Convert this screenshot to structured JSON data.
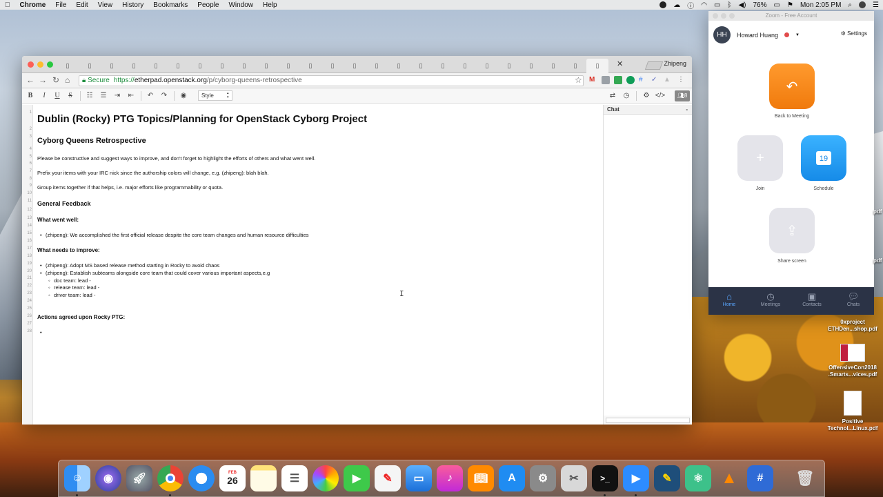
{
  "menubar": {
    "apple": "",
    "app": "Chrome",
    "items": [
      "File",
      "Edit",
      "View",
      "History",
      "Bookmarks",
      "People",
      "Window",
      "Help"
    ],
    "battery": "76%",
    "clock": "Mon 2:05 PM"
  },
  "browser": {
    "profile": "Zhipeng",
    "tab_icon": "etherpad-favicon",
    "url": {
      "secure_label": "Secure",
      "scheme": "https://",
      "host": "etherpad.openstack.org",
      "path": "/p/cyborg-queens-retrospective"
    }
  },
  "toolbar": {
    "bold": "B",
    "italic": "I",
    "underline": "U",
    "strike": "S",
    "style_select": "Style",
    "users_count": "8"
  },
  "document": {
    "line_numbers": [
      "1",
      "2",
      "3",
      "4",
      "5",
      "6",
      "7",
      "8",
      "9",
      "10",
      "11",
      "12",
      "13",
      "14",
      "15",
      "16",
      "17",
      "18",
      "19",
      "20",
      "21",
      "22",
      "23",
      "24",
      "25",
      "26",
      "27",
      "28"
    ],
    "title": "Dublin (Rocky) PTG Topics/Planning for OpenStack Cyborg Project",
    "subtitle": "Cyborg Queens Retrospective",
    "intro1": "Please be constructive and suggest ways to improve, and don't forget to highlight the efforts of others and what went well.",
    "intro2": "Prefix your items with your IRC nick since the authorship colors will change, e.g. (zhipeng): blah blah.",
    "intro3": "Group items together if that helps, i.e. major efforts like programmability or quota.",
    "section_general": "General Feedback",
    "went_well_label": "What went well:",
    "went_well_item": "(zhipeng): We accomplished the first official release despite the core team changes and human resource difficulties",
    "improve_label": "What needs to improve:",
    "improve_item1": "(zhipeng): Adopt MS based release method starting in Rocky to avoid chaos",
    "improve_item2": "(zhipeng): Establish subteams alongside core team that could cover various important aspects,e.g",
    "sub_doc": "doc team: lead -",
    "sub_release": "release team: lead -",
    "sub_driver": "driver team: lead -",
    "actions_label": "Actions agreed upon Rocky PTG:"
  },
  "chat": {
    "title": "Chat",
    "minimize": "-"
  },
  "zoom": {
    "window_title": "Zoom - Free Account",
    "initials": "HH",
    "user_name": "Howard Huang",
    "settings": "Settings",
    "back_to_meeting": "Back to Meeting",
    "join": "Join",
    "schedule": "Schedule",
    "share_screen": "Share screen",
    "calendar_day": "19",
    "nav": [
      "Home",
      "Meetings",
      "Contacts",
      "Chats"
    ]
  },
  "desktop_files": [
    {
      "line1": "0xproject",
      "line2": "ETHDen...shop.pdf"
    },
    {
      "line1": "OffensiveCon2018",
      "line2": ".Smarts...vices.pdf"
    },
    {
      "line1": "Positive",
      "line2": "Technol...Linux.pdf"
    }
  ],
  "edge_labels": [
    "pdf",
    "pdf"
  ],
  "dock": {
    "calendar_month": "FEB",
    "calendar_day": "26"
  }
}
